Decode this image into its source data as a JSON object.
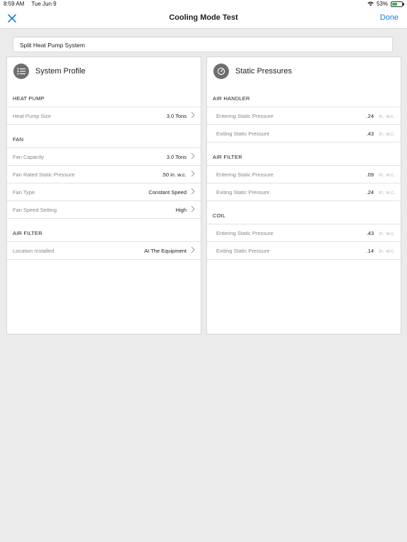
{
  "status": {
    "time": "8:59 AM",
    "date": "Tue Jun 9",
    "battery": "53%"
  },
  "nav": {
    "title": "Cooling Mode Test",
    "done_label": "Done"
  },
  "system_type": "Split Heat Pump System",
  "system_profile": {
    "title": "System Profile",
    "heat_pump": {
      "label": "HEAT PUMP",
      "rows": [
        {
          "label": "Heat Pump Size",
          "value": "3.0 Tons"
        }
      ]
    },
    "fan": {
      "label": "FAN",
      "rows": [
        {
          "label": "Fan Capacity",
          "value": "3.0 Tons"
        },
        {
          "label": "Fan Rated Static Pressure",
          "value": ".50 in. w.c."
        },
        {
          "label": "Fan Type",
          "value": "Constant Speed"
        },
        {
          "label": "Fan Speed Setting",
          "value": "High"
        }
      ]
    },
    "air_filter": {
      "label": "AIR FILTER",
      "rows": [
        {
          "label": "Location Installed",
          "value": "At The Equipment"
        }
      ]
    }
  },
  "static_pressures": {
    "title": "Static Pressures",
    "unit": "in. w.c.",
    "air_handler": {
      "label": "AIR HANDLER",
      "rows": [
        {
          "label": "Entering Static Pressure",
          "value": ".24"
        },
        {
          "label": "Exiting Static Pressure",
          "value": ".43"
        }
      ]
    },
    "air_filter": {
      "label": "AIR FILTER",
      "rows": [
        {
          "label": "Entering Static Pressure",
          "value": ".09"
        },
        {
          "label": "Exiting Static Pressure",
          "value": ".24"
        }
      ]
    },
    "coil": {
      "label": "COIL",
      "rows": [
        {
          "label": "Entering Static Pressure",
          "value": ".43"
        },
        {
          "label": "Exiting Static Pressure",
          "value": ".14"
        }
      ]
    }
  },
  "colors": {
    "accent": "#1a7ee0",
    "icon_bg": "#6e6e6e",
    "page_bg": "#ebebeb"
  }
}
